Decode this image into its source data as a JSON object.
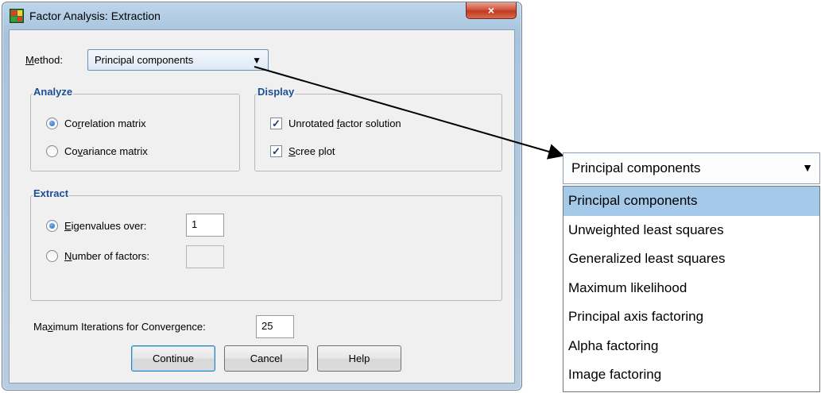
{
  "window": {
    "title": "Factor Analysis: Extraction",
    "close_glyph": "×"
  },
  "method": {
    "label": "Method:",
    "selected": "Principal components",
    "options": [
      "Principal components",
      "Unweighted least squares",
      "Generalized least squares",
      "Maximum likelihood",
      "Principal axis factoring",
      "Alpha factoring",
      "Image factoring"
    ],
    "selected_index": 0
  },
  "analyze": {
    "title": "Analyze",
    "correlation": {
      "label": "Correlation matrix",
      "checked": true
    },
    "covariance": {
      "label": "Covariance matrix",
      "checked": false
    }
  },
  "display": {
    "title": "Display",
    "unrotated": {
      "label": "Unrotated factor solution",
      "checked": true
    },
    "scree": {
      "label": "Scree plot",
      "checked": true
    }
  },
  "extract": {
    "title": "Extract",
    "eigen": {
      "label": "Eigenvalues over:",
      "checked": true,
      "value": "1"
    },
    "nfactors": {
      "label": "Number of factors:",
      "checked": false,
      "value": ""
    }
  },
  "iterations": {
    "label": "Maximum Iterations for Convergence:",
    "value": "25"
  },
  "buttons": {
    "continue": "Continue",
    "cancel": "Cancel",
    "help": "Help"
  },
  "icons": {
    "dropdown": "▼",
    "check": "✓"
  },
  "colors": {
    "group_title": "#1c4f96",
    "selected_item": "#a5cae9",
    "close_button": "#c03a22"
  }
}
